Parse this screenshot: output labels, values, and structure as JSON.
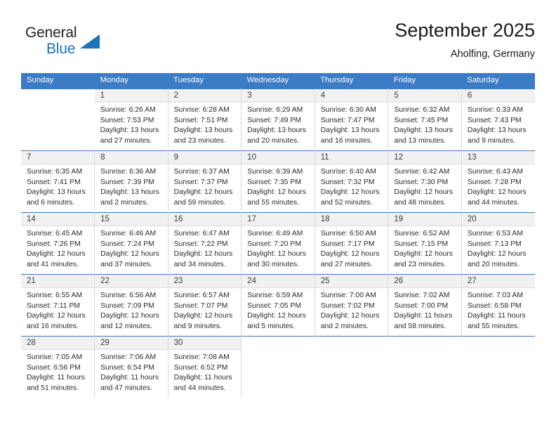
{
  "brand": {
    "name_top": "General",
    "name_bottom": "Blue",
    "triangle_color": "#1a72ba",
    "text_color": "#231f20"
  },
  "header": {
    "title": "September 2025",
    "subtitle": "Aholfing, Germany"
  },
  "theme": {
    "header_bg": "#3b7cc4",
    "header_text": "#ffffff",
    "daynum_bg": "#f1f1f1",
    "row_divider": "#3b7cc4",
    "cell_divider": "#d8d8d8"
  },
  "calendar": {
    "weekday_headers": [
      "Sunday",
      "Monday",
      "Tuesday",
      "Wednesday",
      "Thursday",
      "Friday",
      "Saturday"
    ],
    "labels": {
      "sunrise": "Sunrise:",
      "sunset": "Sunset:",
      "daylight": "Daylight:"
    },
    "weeks": [
      [
        {
          "day": "",
          "sunrise": "",
          "sunset": "",
          "daylight": ""
        },
        {
          "day": "1",
          "sunrise": "Sunrise: 6:26 AM",
          "sunset": "Sunset: 7:53 PM",
          "daylight": "Daylight: 13 hours and 27 minutes."
        },
        {
          "day": "2",
          "sunrise": "Sunrise: 6:28 AM",
          "sunset": "Sunset: 7:51 PM",
          "daylight": "Daylight: 13 hours and 23 minutes."
        },
        {
          "day": "3",
          "sunrise": "Sunrise: 6:29 AM",
          "sunset": "Sunset: 7:49 PM",
          "daylight": "Daylight: 13 hours and 20 minutes."
        },
        {
          "day": "4",
          "sunrise": "Sunrise: 6:30 AM",
          "sunset": "Sunset: 7:47 PM",
          "daylight": "Daylight: 13 hours and 16 minutes."
        },
        {
          "day": "5",
          "sunrise": "Sunrise: 6:32 AM",
          "sunset": "Sunset: 7:45 PM",
          "daylight": "Daylight: 13 hours and 13 minutes."
        },
        {
          "day": "6",
          "sunrise": "Sunrise: 6:33 AM",
          "sunset": "Sunset: 7:43 PM",
          "daylight": "Daylight: 13 hours and 9 minutes."
        }
      ],
      [
        {
          "day": "7",
          "sunrise": "Sunrise: 6:35 AM",
          "sunset": "Sunset: 7:41 PM",
          "daylight": "Daylight: 13 hours and 6 minutes."
        },
        {
          "day": "8",
          "sunrise": "Sunrise: 6:36 AM",
          "sunset": "Sunset: 7:39 PM",
          "daylight": "Daylight: 13 hours and 2 minutes."
        },
        {
          "day": "9",
          "sunrise": "Sunrise: 6:37 AM",
          "sunset": "Sunset: 7:37 PM",
          "daylight": "Daylight: 12 hours and 59 minutes."
        },
        {
          "day": "10",
          "sunrise": "Sunrise: 6:39 AM",
          "sunset": "Sunset: 7:35 PM",
          "daylight": "Daylight: 12 hours and 55 minutes."
        },
        {
          "day": "11",
          "sunrise": "Sunrise: 6:40 AM",
          "sunset": "Sunset: 7:32 PM",
          "daylight": "Daylight: 12 hours and 52 minutes."
        },
        {
          "day": "12",
          "sunrise": "Sunrise: 6:42 AM",
          "sunset": "Sunset: 7:30 PM",
          "daylight": "Daylight: 12 hours and 48 minutes."
        },
        {
          "day": "13",
          "sunrise": "Sunrise: 6:43 AM",
          "sunset": "Sunset: 7:28 PM",
          "daylight": "Daylight: 12 hours and 44 minutes."
        }
      ],
      [
        {
          "day": "14",
          "sunrise": "Sunrise: 6:45 AM",
          "sunset": "Sunset: 7:26 PM",
          "daylight": "Daylight: 12 hours and 41 minutes."
        },
        {
          "day": "15",
          "sunrise": "Sunrise: 6:46 AM",
          "sunset": "Sunset: 7:24 PM",
          "daylight": "Daylight: 12 hours and 37 minutes."
        },
        {
          "day": "16",
          "sunrise": "Sunrise: 6:47 AM",
          "sunset": "Sunset: 7:22 PM",
          "daylight": "Daylight: 12 hours and 34 minutes."
        },
        {
          "day": "17",
          "sunrise": "Sunrise: 6:49 AM",
          "sunset": "Sunset: 7:20 PM",
          "daylight": "Daylight: 12 hours and 30 minutes."
        },
        {
          "day": "18",
          "sunrise": "Sunrise: 6:50 AM",
          "sunset": "Sunset: 7:17 PM",
          "daylight": "Daylight: 12 hours and 27 minutes."
        },
        {
          "day": "19",
          "sunrise": "Sunrise: 6:52 AM",
          "sunset": "Sunset: 7:15 PM",
          "daylight": "Daylight: 12 hours and 23 minutes."
        },
        {
          "day": "20",
          "sunrise": "Sunrise: 6:53 AM",
          "sunset": "Sunset: 7:13 PM",
          "daylight": "Daylight: 12 hours and 20 minutes."
        }
      ],
      [
        {
          "day": "21",
          "sunrise": "Sunrise: 6:55 AM",
          "sunset": "Sunset: 7:11 PM",
          "daylight": "Daylight: 12 hours and 16 minutes."
        },
        {
          "day": "22",
          "sunrise": "Sunrise: 6:56 AM",
          "sunset": "Sunset: 7:09 PM",
          "daylight": "Daylight: 12 hours and 12 minutes."
        },
        {
          "day": "23",
          "sunrise": "Sunrise: 6:57 AM",
          "sunset": "Sunset: 7:07 PM",
          "daylight": "Daylight: 12 hours and 9 minutes."
        },
        {
          "day": "24",
          "sunrise": "Sunrise: 6:59 AM",
          "sunset": "Sunset: 7:05 PM",
          "daylight": "Daylight: 12 hours and 5 minutes."
        },
        {
          "day": "25",
          "sunrise": "Sunrise: 7:00 AM",
          "sunset": "Sunset: 7:02 PM",
          "daylight": "Daylight: 12 hours and 2 minutes."
        },
        {
          "day": "26",
          "sunrise": "Sunrise: 7:02 AM",
          "sunset": "Sunset: 7:00 PM",
          "daylight": "Daylight: 11 hours and 58 minutes."
        },
        {
          "day": "27",
          "sunrise": "Sunrise: 7:03 AM",
          "sunset": "Sunset: 6:58 PM",
          "daylight": "Daylight: 11 hours and 55 minutes."
        }
      ],
      [
        {
          "day": "28",
          "sunrise": "Sunrise: 7:05 AM",
          "sunset": "Sunset: 6:56 PM",
          "daylight": "Daylight: 11 hours and 51 minutes."
        },
        {
          "day": "29",
          "sunrise": "Sunrise: 7:06 AM",
          "sunset": "Sunset: 6:54 PM",
          "daylight": "Daylight: 11 hours and 47 minutes."
        },
        {
          "day": "30",
          "sunrise": "Sunrise: 7:08 AM",
          "sunset": "Sunset: 6:52 PM",
          "daylight": "Daylight: 11 hours and 44 minutes."
        },
        {
          "day": "",
          "sunrise": "",
          "sunset": "",
          "daylight": ""
        },
        {
          "day": "",
          "sunrise": "",
          "sunset": "",
          "daylight": ""
        },
        {
          "day": "",
          "sunrise": "",
          "sunset": "",
          "daylight": ""
        },
        {
          "day": "",
          "sunrise": "",
          "sunset": "",
          "daylight": ""
        }
      ]
    ]
  }
}
